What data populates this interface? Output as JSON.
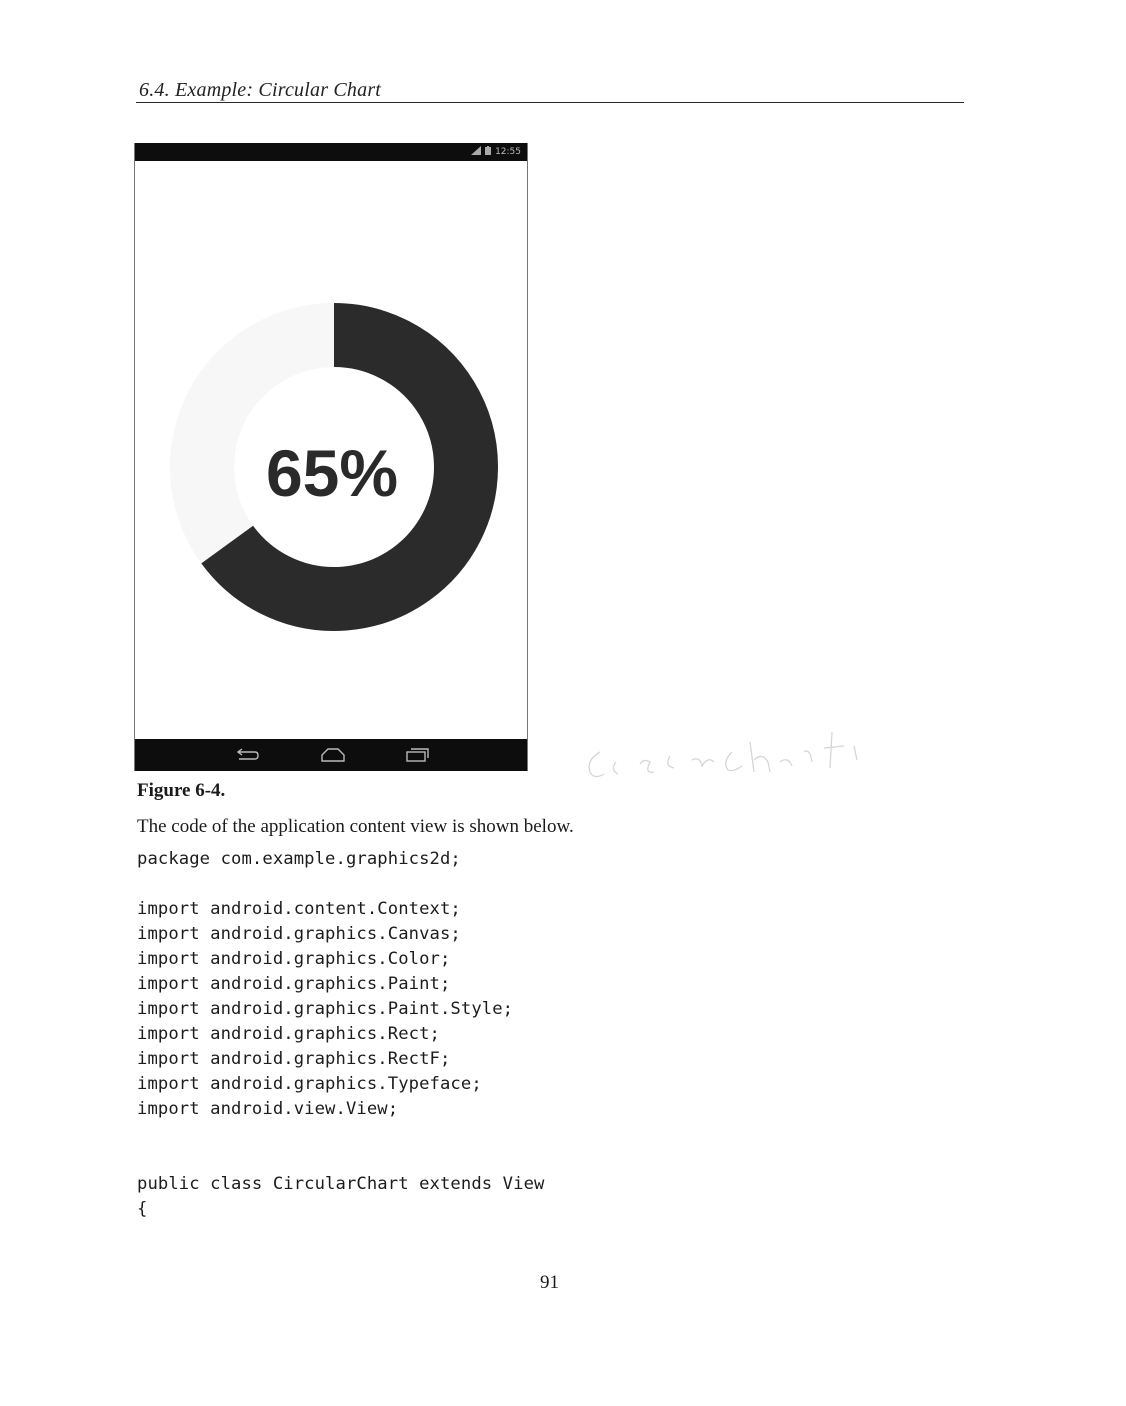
{
  "header": {
    "title": "6.4.  Example: Circular Chart"
  },
  "phone": {
    "status_time": "12:55",
    "progress_percent": 65,
    "percent_label": "65%",
    "colors": {
      "arc": "#2b2b2b",
      "track": "#f6f6f6",
      "bars": "#0d0d0d"
    }
  },
  "figure": {
    "caption": "Figure 6-4."
  },
  "text": {
    "intro": "The code of the application content view is shown below."
  },
  "code": {
    "package_line": "package com.example.graphics2d;",
    "imports": [
      "import android.content.Context;",
      "import android.graphics.Canvas;",
      "import android.graphics.Color;",
      "import android.graphics.Paint;",
      "import android.graphics.Paint.Style;",
      "import android.graphics.Rect;",
      "import android.graphics.RectF;",
      "import android.graphics.Typeface;",
      "import android.view.View;"
    ],
    "class_line": "public class CircularChart extends View",
    "open_brace": "{"
  },
  "annotation": {
    "handwritten": "CircularChart"
  },
  "footer": {
    "page_number": "91"
  }
}
